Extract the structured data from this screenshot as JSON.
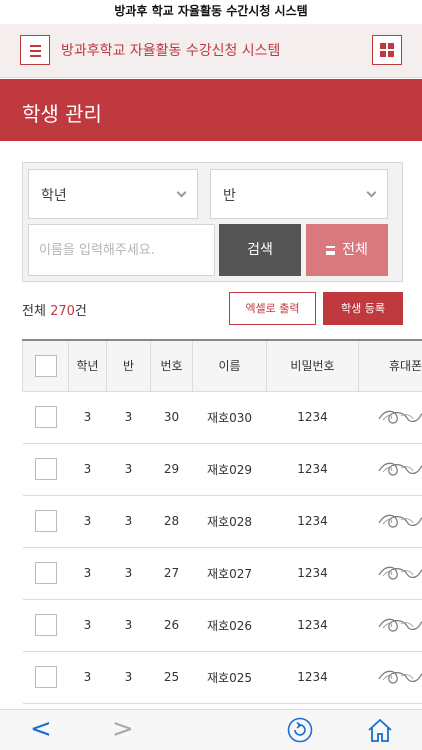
{
  "status_title": "방과후 학교 자율활동 수간시청 시스템",
  "header": {
    "title": "방과후학교 자율활동 수강신청 시스템"
  },
  "page": {
    "title": "학생 관리"
  },
  "search": {
    "grade_select": "학년",
    "class_select": "반",
    "name_placeholder": "이름을 입력해주세요.",
    "search_label": "검색",
    "all_label": "전체"
  },
  "summary": {
    "prefix": "전체 ",
    "count": "270",
    "suffix": "건"
  },
  "actions": {
    "excel_label": "엑셀로 출력",
    "register_label": "학생 등록"
  },
  "table": {
    "columns": [
      "학년",
      "반",
      "번호",
      "이름",
      "비밀번호",
      "휴대폰"
    ],
    "rows": [
      {
        "grade": "3",
        "class": "3",
        "number": "30",
        "name": "재호030",
        "password": "1234"
      },
      {
        "grade": "3",
        "class": "3",
        "number": "29",
        "name": "재호029",
        "password": "1234"
      },
      {
        "grade": "3",
        "class": "3",
        "number": "28",
        "name": "재호028",
        "password": "1234"
      },
      {
        "grade": "3",
        "class": "3",
        "number": "27",
        "name": "재호027",
        "password": "1234"
      },
      {
        "grade": "3",
        "class": "3",
        "number": "26",
        "name": "재호026",
        "password": "1234"
      },
      {
        "grade": "3",
        "class": "3",
        "number": "25",
        "name": "재호025",
        "password": "1234"
      }
    ]
  },
  "colors": {
    "accent": "#c0393f",
    "accent_light": "#d9797d",
    "search_button": "#555555",
    "nav_blue": "#1a6fd1"
  },
  "icons": {
    "menu": "hamburger-icon",
    "grid": "grid-icon",
    "refresh": "refresh-icon",
    "home": "home-icon"
  }
}
